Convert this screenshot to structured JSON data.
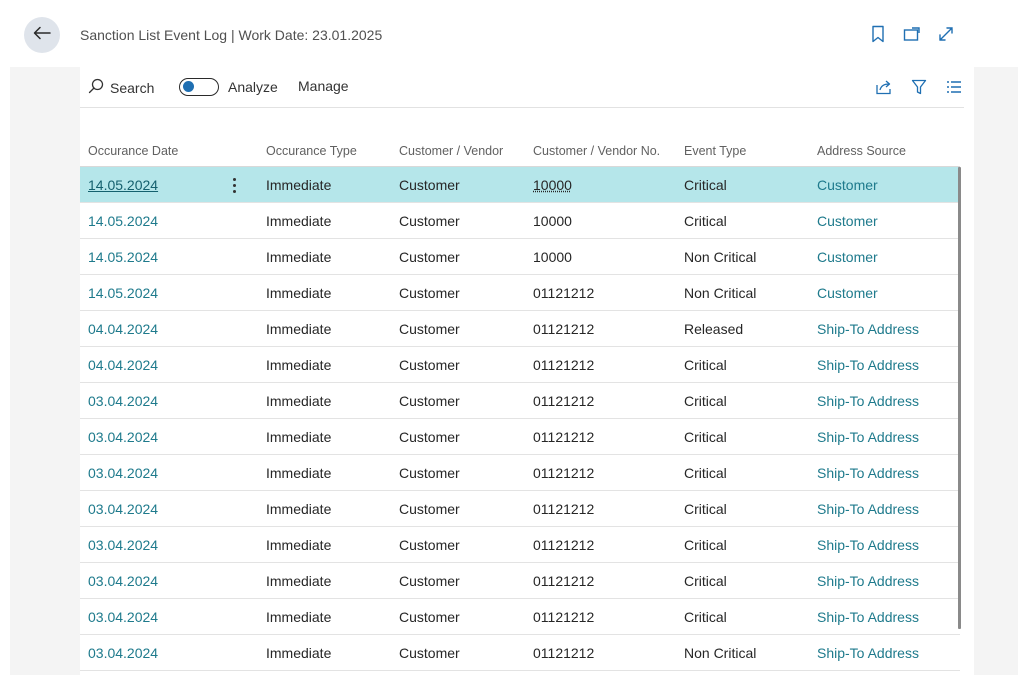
{
  "header": {
    "title": "Sanction List Event Log | Work Date: 23.01.2025",
    "icons": [
      "back-arrow-icon",
      "bookmark-icon",
      "open-in-new-window-icon",
      "expand-icon"
    ]
  },
  "actionbar": {
    "search_label": "Search",
    "analyze_label": "Analyze",
    "manage_label": "Manage",
    "right_icons": [
      "share-icon",
      "filter-icon",
      "list-view-icon"
    ]
  },
  "table": {
    "columns": [
      "Occurance Date",
      "Occurance Type",
      "Customer / Vendor",
      "Customer / Vendor No.",
      "Event Type",
      "Address Source"
    ],
    "rows": [
      [
        "14.05.2024",
        "Immediate",
        "Customer",
        "10000",
        "Critical",
        "Customer"
      ],
      [
        "14.05.2024",
        "Immediate",
        "Customer",
        "10000",
        "Critical",
        "Customer"
      ],
      [
        "14.05.2024",
        "Immediate",
        "Customer",
        "10000",
        "Non Critical",
        "Customer"
      ],
      [
        "14.05.2024",
        "Immediate",
        "Customer",
        "01121212",
        "Non Critical",
        "Customer"
      ],
      [
        "04.04.2024",
        "Immediate",
        "Customer",
        "01121212",
        "Released",
        "Ship-To Address"
      ],
      [
        "04.04.2024",
        "Immediate",
        "Customer",
        "01121212",
        "Critical",
        "Ship-To Address"
      ],
      [
        "03.04.2024",
        "Immediate",
        "Customer",
        "01121212",
        "Critical",
        "Ship-To Address"
      ],
      [
        "03.04.2024",
        "Immediate",
        "Customer",
        "01121212",
        "Critical",
        "Ship-To Address"
      ],
      [
        "03.04.2024",
        "Immediate",
        "Customer",
        "01121212",
        "Critical",
        "Ship-To Address"
      ],
      [
        "03.04.2024",
        "Immediate",
        "Customer",
        "01121212",
        "Critical",
        "Ship-To Address"
      ],
      [
        "03.04.2024",
        "Immediate",
        "Customer",
        "01121212",
        "Critical",
        "Ship-To Address"
      ],
      [
        "03.04.2024",
        "Immediate",
        "Customer",
        "01121212",
        "Critical",
        "Ship-To Address"
      ],
      [
        "03.04.2024",
        "Immediate",
        "Customer",
        "01121212",
        "Critical",
        "Ship-To Address"
      ],
      [
        "03.04.2024",
        "Immediate",
        "Customer",
        "01121212",
        "Non Critical",
        "Ship-To Address"
      ]
    ]
  },
  "colors": {
    "selected_row": "#b5e6ea",
    "link": "#1e7a8c",
    "back_button_bg": "#dfe4eb"
  }
}
